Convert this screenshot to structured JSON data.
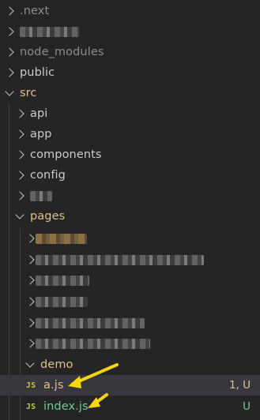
{
  "explorer": {
    "items": [
      {
        "label": ".next",
        "type": "folder",
        "state": "closed",
        "depth": 0,
        "dim": true
      },
      {
        "label": "",
        "type": "folder",
        "state": "closed",
        "depth": 0,
        "redacted": true
      },
      {
        "label": "node_modules",
        "type": "folder",
        "state": "closed",
        "depth": 0,
        "dim": true
      },
      {
        "label": "public",
        "type": "folder",
        "state": "closed",
        "depth": 0
      },
      {
        "label": "src",
        "type": "folder",
        "state": "open",
        "depth": 0,
        "color": "warn"
      },
      {
        "label": "api",
        "type": "folder",
        "state": "closed",
        "depth": 1
      },
      {
        "label": "app",
        "type": "folder",
        "state": "closed",
        "depth": 1
      },
      {
        "label": "components",
        "type": "folder",
        "state": "closed",
        "depth": 1
      },
      {
        "label": "config",
        "type": "folder",
        "state": "closed",
        "depth": 1
      },
      {
        "label": "",
        "type": "folder",
        "state": "closed",
        "depth": 1,
        "redacted": true
      },
      {
        "label": "pages",
        "type": "folder",
        "state": "open",
        "depth": 1,
        "color": "warn"
      },
      {
        "label": "",
        "type": "folder",
        "state": "closed",
        "depth": 2,
        "redacted": true
      },
      {
        "label": "",
        "type": "folder",
        "state": "closed",
        "depth": 2,
        "redacted": true
      },
      {
        "label": "",
        "type": "folder",
        "state": "closed",
        "depth": 2,
        "redacted": true
      },
      {
        "label": "",
        "type": "folder",
        "state": "closed",
        "depth": 2,
        "redacted": true
      },
      {
        "label": "",
        "type": "folder",
        "state": "closed",
        "depth": 2,
        "redacted": true
      },
      {
        "label": "",
        "type": "folder",
        "state": "closed",
        "depth": 2,
        "redacted": true
      },
      {
        "label": "demo",
        "type": "folder",
        "state": "open",
        "depth": 2,
        "color": "warn"
      },
      {
        "label": "a.js",
        "type": "file",
        "depth": 3,
        "color": "warn",
        "badge": "JS",
        "status": "1, U",
        "selected": true
      },
      {
        "label": "index.js",
        "type": "file",
        "depth": 3,
        "color": "git",
        "badge": "JS",
        "status": "U"
      }
    ]
  },
  "colors": {
    "background": "#252526",
    "text": "#cccccc",
    "modified": "#e2c08d",
    "untracked": "#73c991",
    "js_badge": "#cbcb41",
    "arrow": "#f5d60a"
  }
}
